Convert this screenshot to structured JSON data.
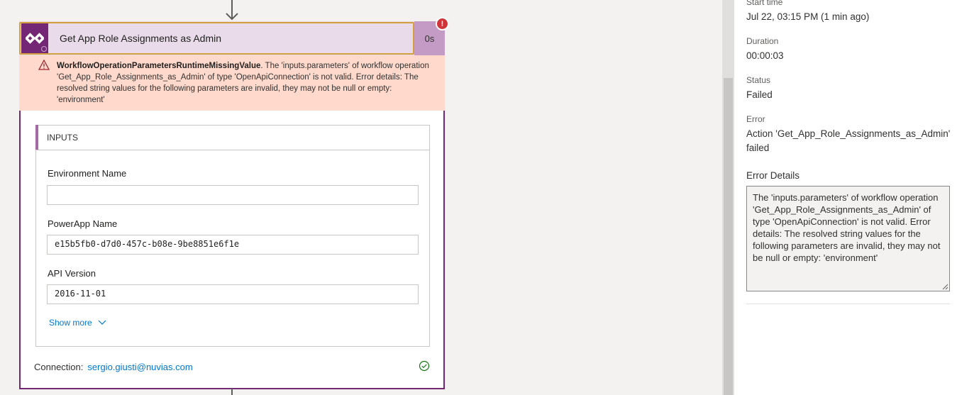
{
  "card": {
    "title": "Get App Role Assignments as Admin",
    "duration": "0s",
    "error_indicator": "!",
    "error_code": "WorkflowOperationParametersRuntimeMissingValue",
    "error_message": ". The 'inputs.parameters' of workflow operation 'Get_App_Role_Assignments_as_Admin' of type 'OpenApiConnection' is not valid. Error details: The resolved string values for the following parameters are invalid, they may not be null or empty: 'environment'",
    "inputs_header": "INPUTS",
    "fields": [
      {
        "label": "Environment Name",
        "value": ""
      },
      {
        "label": "PowerApp Name",
        "value": "e15b5fb0-d7d0-457c-b08e-9be8851e6f1e"
      },
      {
        "label": "API Version",
        "value": "2016-11-01"
      }
    ],
    "show_more": "Show more",
    "connection_label": "Connection:",
    "connection_value": "sergio.giusti@nuvias.com",
    "icons": {
      "app": "powerapps-icon",
      "warning": "warning-icon",
      "chevron": "chevron-down-icon",
      "check": "check-circle-icon",
      "arrow": "arrow-down-icon"
    }
  },
  "side_panel": {
    "start_time_label": "Start time",
    "start_time_value": "Jul 22, 03:15 PM (1 min ago)",
    "duration_label": "Duration",
    "duration_value": "00:00:03",
    "status_label": "Status",
    "status_value": "Failed",
    "error_label": "Error",
    "error_value": "Action 'Get_App_Role_Assignments_as_Admin' failed",
    "error_details_label": "Error Details",
    "error_details_value": "The 'inputs.parameters' of workflow operation 'Get_App_Role_Assignments_as_Admin' of type 'OpenApiConnection' is not valid. Error details: The resolved string values for the following parameters are invalid, they may not be null or empty: 'environment'"
  },
  "colors": {
    "accent": "#742774",
    "header_bg": "#e9dbe9",
    "error_banner_bg": "#fed9cc",
    "error_red": "#d13438",
    "link": "#0078d4",
    "success": "#107c10"
  }
}
